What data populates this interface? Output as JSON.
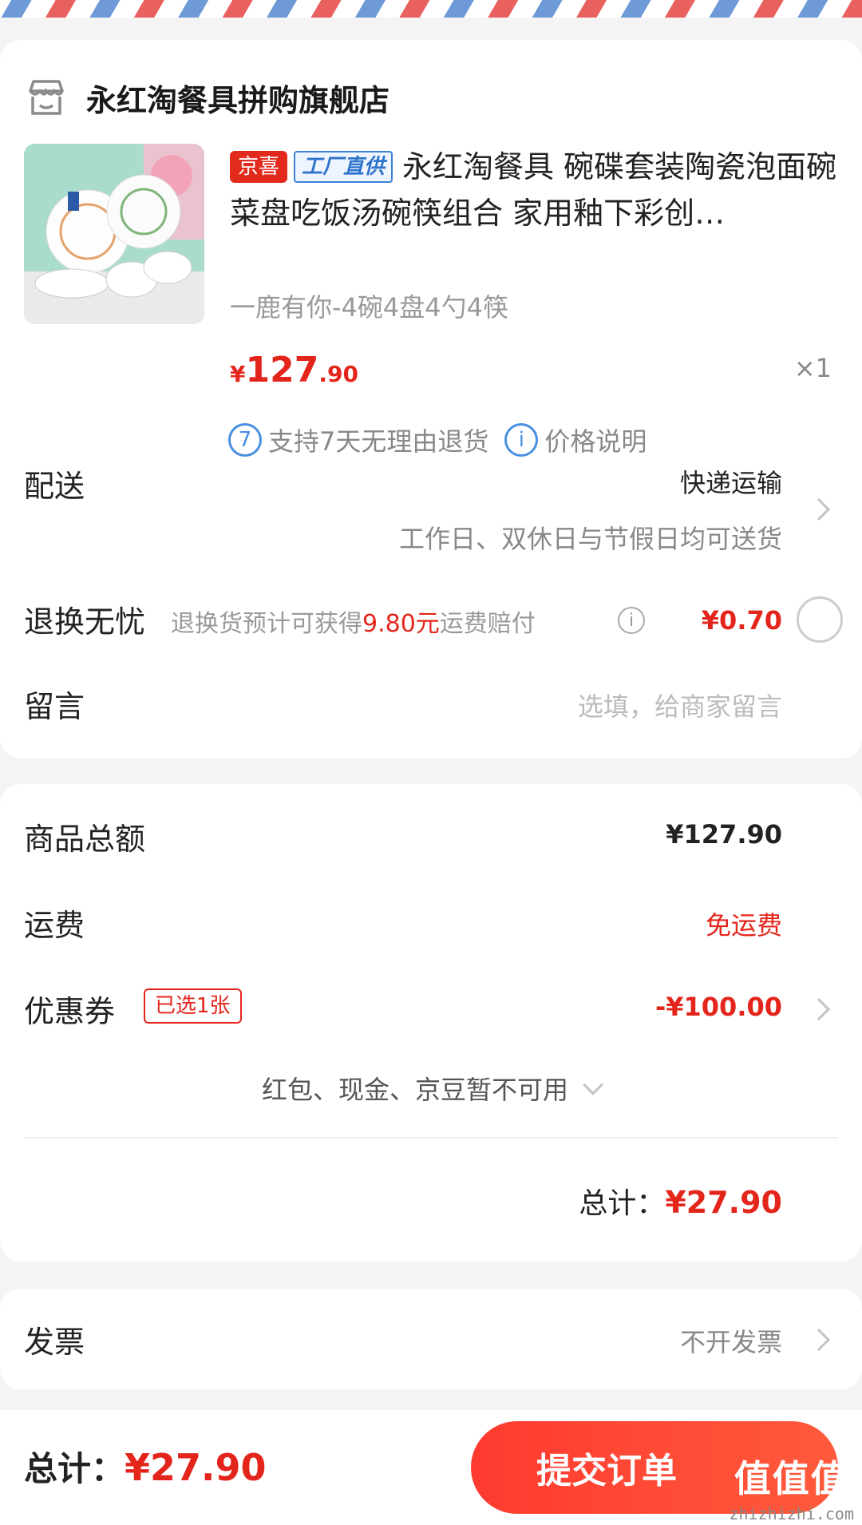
{
  "shop": {
    "name": "永红淘餐具拼购旗舰店",
    "icon": "store-icon"
  },
  "product": {
    "tag_jx": "京喜",
    "tag_factory": "工厂直供",
    "title": "永红淘餐具 碗碟套装陶瓷泡面碗菜盘吃饭汤碗筷组合 家用釉下彩创…",
    "variant": "一鹿有你-4碗4盘4勺4筷",
    "price_currency": "¥",
    "price_int": "127",
    "price_dec": ".90",
    "qty": "×1"
  },
  "services": {
    "return_icon_text": "7",
    "return_label": "支持7天无理由退货",
    "price_icon_text": "i",
    "price_label": "价格说明"
  },
  "delivery": {
    "label": "配送",
    "method": "快递运输",
    "note": "工作日、双休日与节假日均可送货"
  },
  "exchange": {
    "label": "退换无忧",
    "desc_prefix": "退换货预计可获得",
    "desc_amount": "9.80元",
    "desc_suffix": "运费赔付",
    "info_icon_text": "i",
    "price": "¥0.70"
  },
  "message": {
    "label": "留言",
    "placeholder": "选填，给商家留言"
  },
  "summary": {
    "goods_label": "商品总额",
    "goods_value": "¥127.90",
    "shipping_label": "运费",
    "shipping_value": "免运费",
    "coupon_label": "优惠券",
    "coupon_badge": "已选1张",
    "coupon_value": "-¥100.00",
    "unavailable": "红包、现金、京豆暂不可用",
    "total_label": "总计：",
    "total_value": "¥27.90"
  },
  "invoice": {
    "label": "发票",
    "value": "不开发票"
  },
  "bottom": {
    "total_label": "总计：",
    "total_value": "¥27.90",
    "submit": "提交订单"
  },
  "watermark": {
    "main": "值值值",
    "sub": "zhizhizhi.com"
  },
  "colors": {
    "accent_red": "#e4251c",
    "blue": "#4a90e2",
    "button": "#ff3a2f"
  }
}
